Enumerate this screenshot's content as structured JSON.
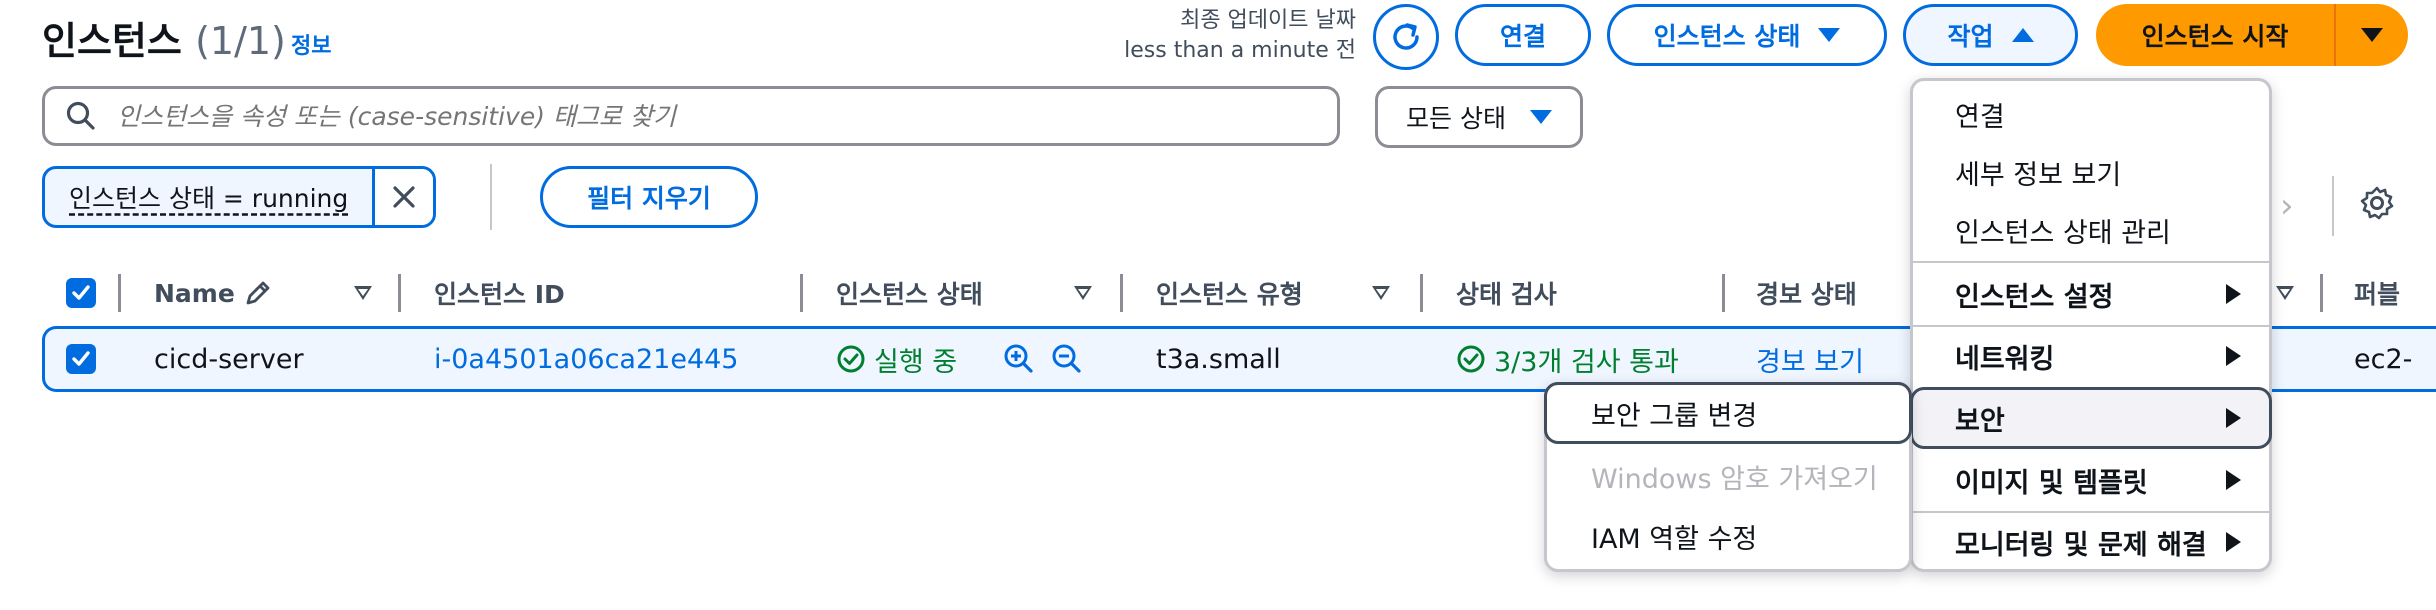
{
  "header": {
    "title": "인스턴스",
    "count": "(1/1)",
    "info_link": "정보",
    "updated_label": "최종 업데이트 날짜",
    "updated_value": "less than a minute 전"
  },
  "toolbar": {
    "refresh_icon": "refresh-icon",
    "connect_label": "연결",
    "instance_state_label": "인스턴스 상태",
    "actions_label": "작업",
    "launch_label": "인스턴스 시작",
    "launch_color": "#ff9900",
    "accent_color": "#006ce0"
  },
  "search": {
    "placeholder": "인스턴스을 속성 또는 (case-sensitive) 태그로 찾기",
    "value": ""
  },
  "status_filter": {
    "selected": "모든 상태"
  },
  "filter_token": {
    "label": "인스턴스 상태 = running",
    "clear_label": "필터 지우기"
  },
  "table": {
    "columns": [
      {
        "label": "Name"
      },
      {
        "label": "인스턴스 ID"
      },
      {
        "label": "인스턴스 상태"
      },
      {
        "label": "인스턴스 유형"
      },
      {
        "label": "상태 검사"
      },
      {
        "label": "경보 상태"
      },
      {
        "label": "퍼블"
      }
    ],
    "rows": [
      {
        "selected": true,
        "name": "cicd-server",
        "instance_id": "i-0a4501a06ca21e445",
        "state": "실행 중",
        "type": "t3a.small",
        "status_check": "3/3개 검사 통과",
        "alarm": "경보 보기",
        "public_dns": "ec2-"
      }
    ]
  },
  "actions_menu": {
    "items": [
      {
        "label": "연결"
      },
      {
        "label": "세부 정보 보기"
      },
      {
        "label": "인스턴스 상태 관리"
      },
      {
        "label": "인스턴스 설정"
      },
      {
        "label": "네트워킹"
      },
      {
        "label": "보안"
      },
      {
        "label": "이미지 및 템플릿"
      },
      {
        "label": "모니터링 및 문제 해결"
      }
    ]
  },
  "security_submenu": {
    "items": [
      {
        "label": "보안 그룹 변경"
      },
      {
        "label": "Windows 암호 가져오기"
      },
      {
        "label": "IAM 역할 수정"
      }
    ]
  }
}
